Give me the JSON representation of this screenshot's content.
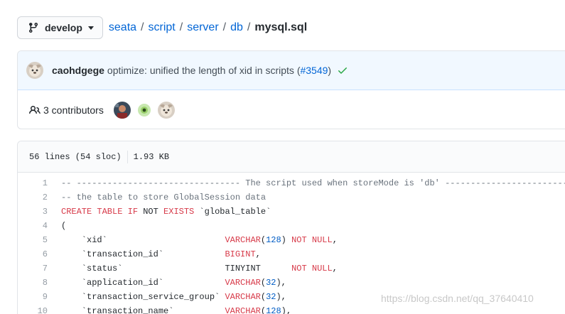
{
  "branch": {
    "label": "develop"
  },
  "breadcrumb": {
    "parts": [
      "seata",
      "script",
      "server",
      "db"
    ],
    "separator": "/",
    "file": "mysql.sql"
  },
  "commit": {
    "author": "caohdgege",
    "message": "optimize: unified the length of xid in scripts (",
    "pr": "#3549",
    "message_end": ")"
  },
  "contributors": {
    "label": "3 contributors"
  },
  "file_info": {
    "lines": "56 lines (54 sloc)",
    "size": "1.93 KB"
  },
  "code_lines": [
    {
      "n": "1",
      "html": "<span class='cm'>-- -------------------------------- The script used when storeMode is 'db' --------------------------------</span>"
    },
    {
      "n": "2",
      "html": "<span class='cm'>-- the table to store GlobalSession data</span>"
    },
    {
      "n": "3",
      "html": "<span class='kw'>CREATE TABLE IF</span> NOT <span class='kw'>EXISTS</span> `global_table`"
    },
    {
      "n": "4",
      "html": "("
    },
    {
      "n": "5",
      "html": "    `xid`                       <span class='kw'>VARCHAR</span>(<span class='nu'>128</span>) <span class='kw'>NOT NULL</span>,"
    },
    {
      "n": "6",
      "html": "    `transaction_id`            <span class='kw'>BIGINT</span>,"
    },
    {
      "n": "7",
      "html": "    `status`                    TINYINT      <span class='kw'>NOT NULL</span>,"
    },
    {
      "n": "8",
      "html": "    `application_id`            <span class='kw'>VARCHAR</span>(<span class='nu'>32</span>),"
    },
    {
      "n": "9",
      "html": "    `transaction_service_group` <span class='kw'>VARCHAR</span>(<span class='nu'>32</span>),"
    },
    {
      "n": "10",
      "html": "    `transaction_name`          <span class='kw'>VARCHAR</span>(<span class='nu'>128</span>),"
    }
  ],
  "watermark": "https://blog.csdn.net/qq_37640410",
  "colors": {
    "link": "#0366d6",
    "keyword": "#d73a49",
    "number": "#005cc5",
    "comment": "#6a737d",
    "success": "#28a745"
  },
  "icons": {
    "branch": "git-branch-icon",
    "check": "check-icon",
    "people": "people-icon"
  }
}
